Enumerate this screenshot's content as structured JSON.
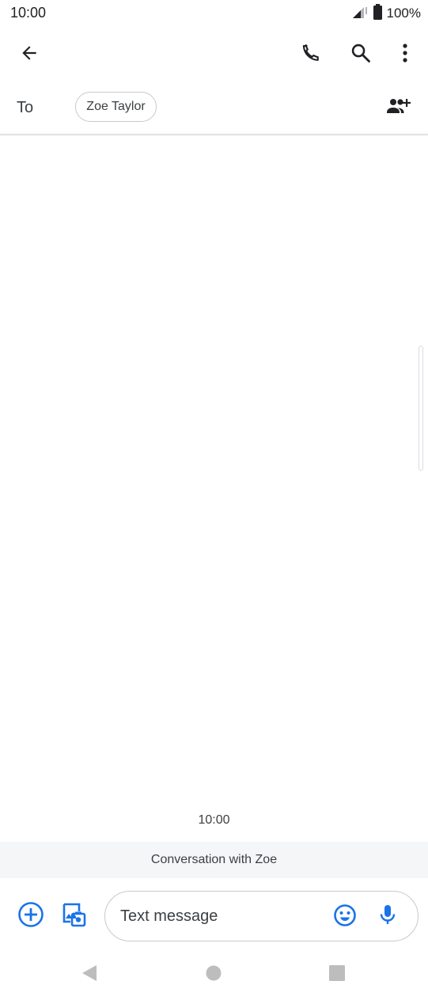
{
  "status_bar": {
    "time": "10:00",
    "battery_percent": "100%",
    "icons": [
      "signal-icon",
      "battery-icon"
    ]
  },
  "app_bar": {
    "icons": [
      "back-arrow-icon",
      "phone-icon",
      "search-icon",
      "more-vert-icon"
    ]
  },
  "recipients": {
    "to_label": "To",
    "chips": [
      "Zoe Taylor"
    ],
    "add_icon": "add-people-icon"
  },
  "conversation": {
    "timestamp": "10:00",
    "banner": "Conversation with Zoe"
  },
  "composer": {
    "placeholder": "Text message",
    "icons": [
      "add-circle-icon",
      "gallery-icon",
      "emoji-icon",
      "mic-icon"
    ]
  },
  "nav_bar": {
    "icons": [
      "nav-back-icon",
      "nav-home-icon",
      "nav-recents-icon"
    ]
  },
  "colors": {
    "accent": "#1a73e8",
    "icon_dark": "#202124",
    "banner_bg": "#f5f6f8"
  }
}
